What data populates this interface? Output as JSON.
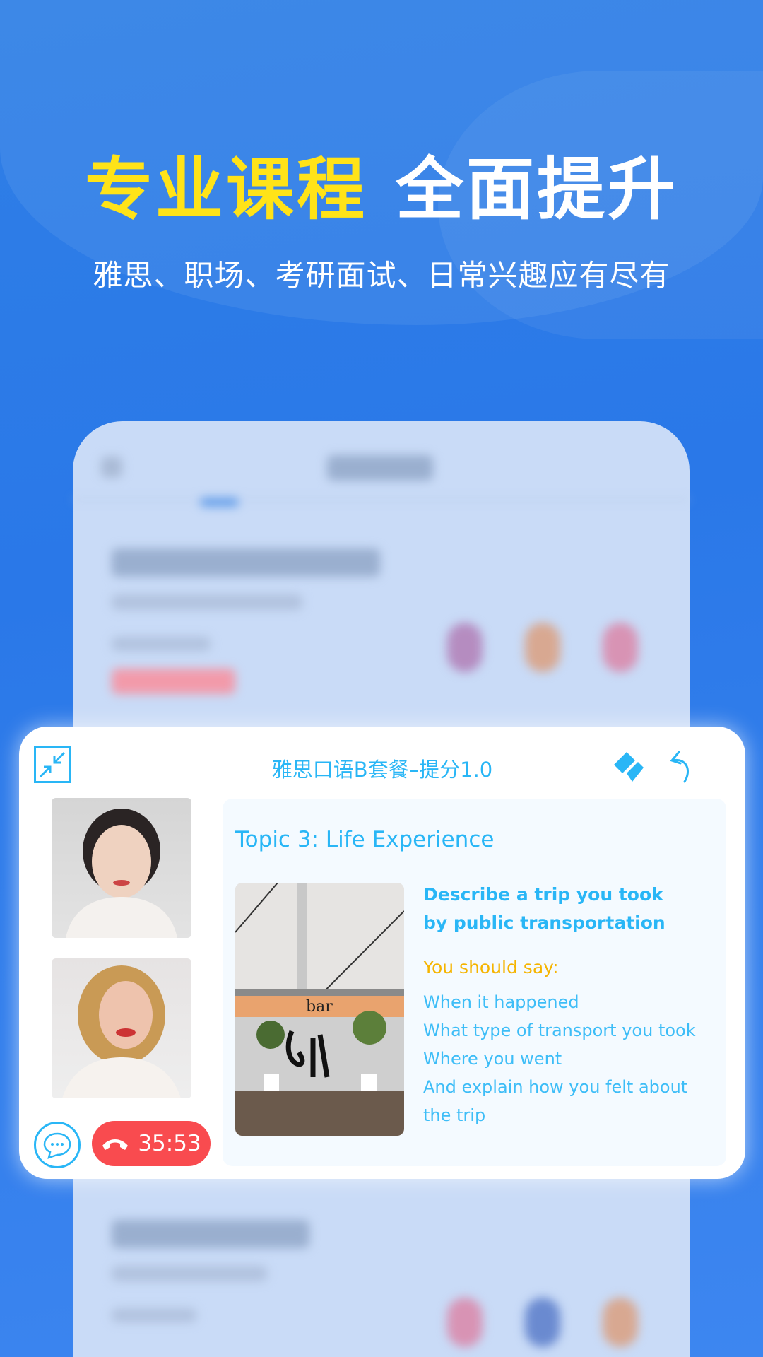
{
  "hero": {
    "title_highlight": "专业课程",
    "title_rest": "全面提升",
    "subtitle": "雅思、职场、考研面试、日常兴趣应有尽有"
  },
  "colors": {
    "accent": "#29b6f6",
    "highlight": "#ffe318",
    "call_red": "#f94b4f",
    "say_orange": "#f5b400"
  },
  "session": {
    "title": "雅思口语B套餐–提分1.0",
    "icons": [
      "collapse-icon",
      "eraser-icon",
      "undo-icon",
      "chat-icon",
      "hang-up-icon"
    ],
    "timer": "35:53",
    "topic": "Topic 3: Life Experience",
    "question_lines": [
      "Describe a trip you took",
      "by public transportation"
    ],
    "you_should_say": "You should say:",
    "points": [
      "When it happened",
      "What type of transport you took",
      "Where you went",
      "And explain how you felt about",
      "the trip"
    ]
  }
}
